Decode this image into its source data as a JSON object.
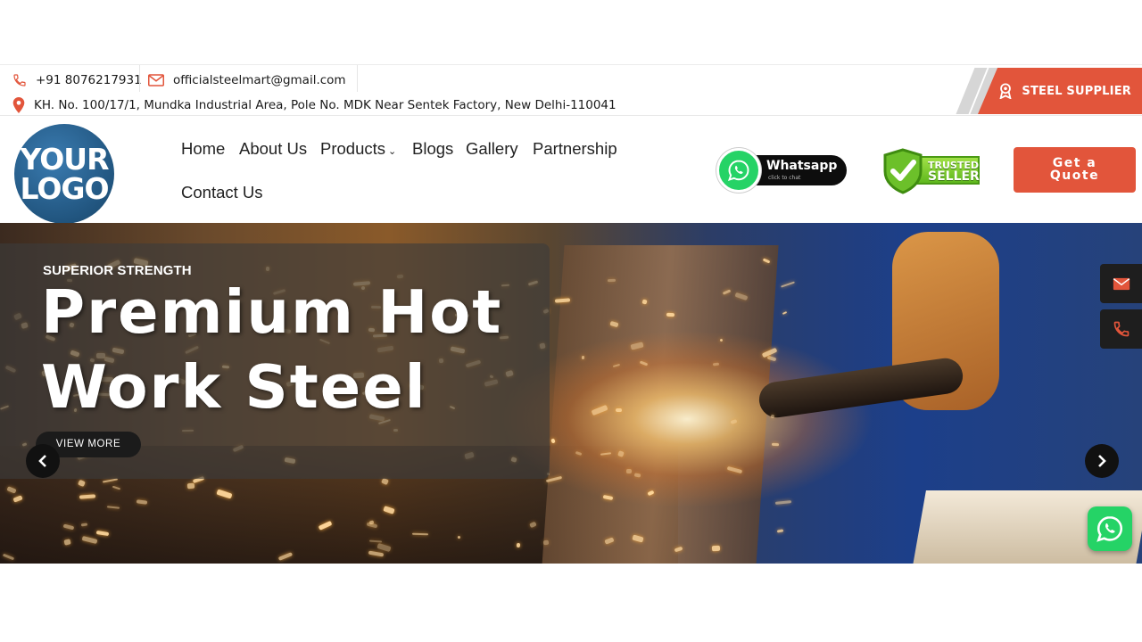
{
  "topbar": {
    "phone": "+91 8076217931",
    "email": "officialsteelmart@gmail.com",
    "address": "KH. No. 100/17/1, Mundka Industrial Area, Pole No. MDK Near Sentek Factory, New Delhi-110041",
    "supplier_label": "STEEL SUPPLIER"
  },
  "header": {
    "logo_line1": "YOUR",
    "logo_line2": "LOGO",
    "nav": {
      "home": "Home",
      "about": "About Us",
      "products": "Products",
      "blogs": "Blogs",
      "gallery": "Gallery",
      "partnership": "Partnership",
      "contact": "Contact Us"
    },
    "whatsapp_label": "Whatsapp",
    "whatsapp_sub": "click to chat",
    "trusted_line1": "TRUSTED",
    "trusted_line2": "SELLER",
    "quote_line1": "Get a",
    "quote_line2": "Quote"
  },
  "hero": {
    "subtitle": "SUPERIOR STRENGTH",
    "title_line1": "Premium Hot",
    "title_line2": "Work Steel",
    "button": "VIEW MORE"
  },
  "colors": {
    "accent": "#e2553b",
    "whatsapp": "#25d366",
    "dark": "#1b1b1b"
  },
  "icons": [
    "phone-icon",
    "mail-icon",
    "location-pin-icon",
    "award-icon",
    "whatsapp-icon",
    "check-shield-icon",
    "chevron-down-icon",
    "chevron-left-icon",
    "chevron-right-icon"
  ]
}
